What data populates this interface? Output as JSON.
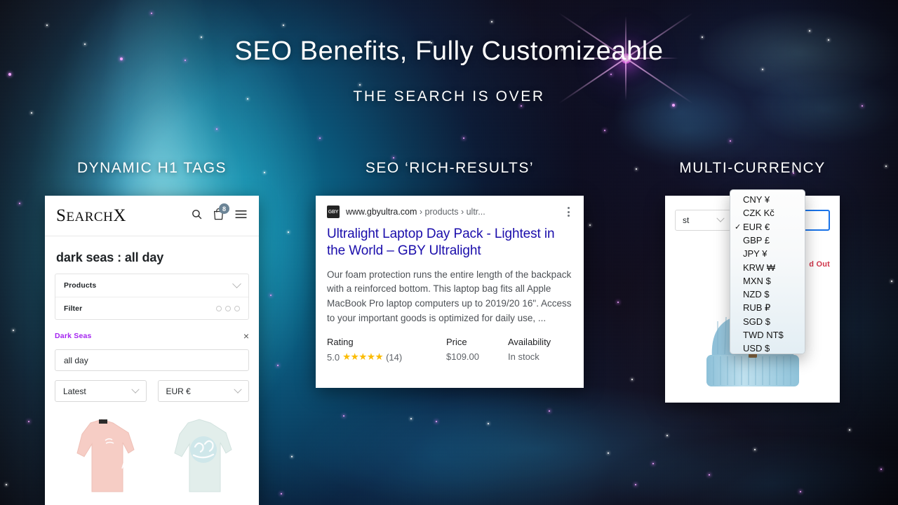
{
  "slide": {
    "title": "SEO Benefits, Fully Customizeable",
    "subtitle": "THE SEARCH IS OVER",
    "columns": [
      {
        "heading": "DYNAMIC H1 TAGS"
      },
      {
        "heading": "SEO ‘RICH-RESULTS’"
      },
      {
        "heading": "MULTI-CURRENCY"
      }
    ],
    "accent_purple": "#a424f0",
    "accent_link_blue": "#1a0dab",
    "accent_star_gold": "#fbbc04",
    "accent_soldout_red": "#d0364b",
    "accent_focus_blue": "#1a73e8"
  },
  "phone": {
    "logo_main": "S",
    "logo_rest": "EARCH",
    "logo_x": "X",
    "icons": {
      "search": "search-icon",
      "cart": "shopping-bag-icon",
      "cart_badge": "8",
      "menu": "hamburger-menu-icon"
    },
    "page_title": "dark seas : all day",
    "accordion": [
      {
        "label": "Products",
        "control": "chevron-down-icon"
      },
      {
        "label": "Filter",
        "control": "three-dots-icon"
      }
    ],
    "active_tag": "Dark Seas",
    "tag_remove": "×",
    "search_value": "all day",
    "sort_select": "Latest",
    "currency_select": "EUR €",
    "products": [
      {
        "name": "Dark Seas pink long sleeve tee",
        "color": "#f6cdc5"
      },
      {
        "name": "Dark Seas mint long sleeve tee",
        "color": "#dfece9"
      }
    ]
  },
  "serp": {
    "favicon_text": "GBY",
    "domain": "www.gbyultra.com",
    "breadcrumb": " › products › ultr...",
    "menu_icon": "kebab-menu-icon",
    "title": "Ultralight Laptop Day Pack - Lightest in the World – GBY Ultralight",
    "description": "Our foam protection runs the entire length of the backpack with a reinforced bottom. This laptop bag fits all Apple MacBook Pro laptop computers up to 2019/20 16\". Access to your important goods is optimized for daily use, ...",
    "rich": {
      "headers": [
        "Rating",
        "Price",
        "Availability"
      ],
      "rating_value": "5.0",
      "rating_stars": "★★★★★",
      "rating_count": "(14)",
      "price": "$109.00",
      "availability": "In stock"
    }
  },
  "currency": {
    "sort_select": "st",
    "sold_out": "d Out",
    "product_name": "light blue knit beanie",
    "menu": {
      "selected": "EUR €",
      "check_glyph": "✓",
      "items": [
        {
          "label": "CNY ¥",
          "selected": false
        },
        {
          "label": "CZK Kč",
          "selected": false
        },
        {
          "label": "EUR €",
          "selected": true
        },
        {
          "label": "GBP £",
          "selected": false
        },
        {
          "label": "JPY ¥",
          "selected": false
        },
        {
          "label": "KRW ₩",
          "selected": false
        },
        {
          "label": "MXN $",
          "selected": false
        },
        {
          "label": "NZD $",
          "selected": false
        },
        {
          "label": "RUB ₽",
          "selected": false
        },
        {
          "label": "SGD $",
          "selected": false
        },
        {
          "label": "TWD NT$",
          "selected": false
        },
        {
          "label": "USD $",
          "selected": false
        }
      ]
    }
  }
}
